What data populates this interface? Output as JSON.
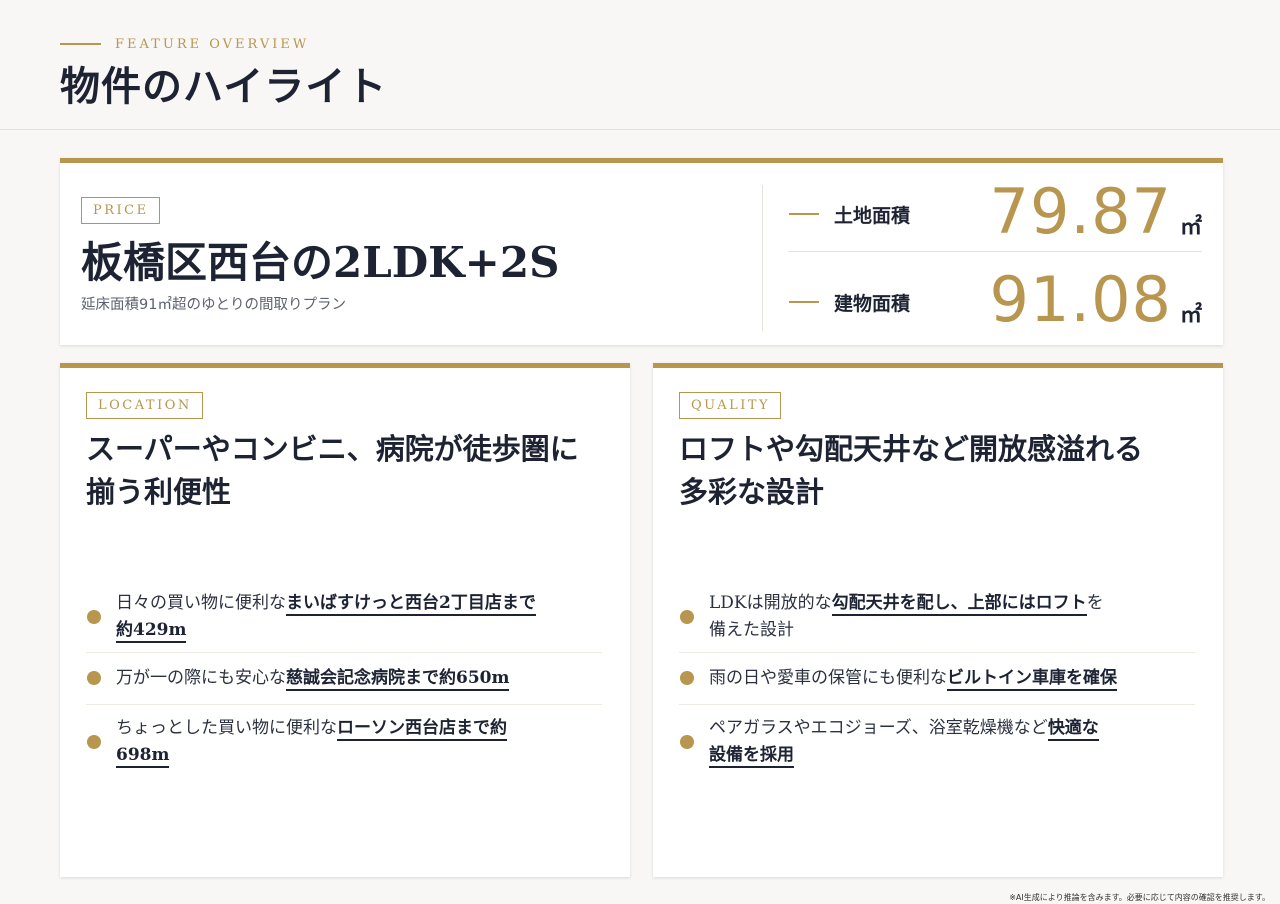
{
  "header": {
    "eyebrow": "FEATURE OVERVIEW",
    "title": "物件のハイライト"
  },
  "price_card": {
    "tag": "PRICE",
    "title": "板橋区西台の2LDK+2S",
    "subtitle": "延床面積91㎡超のゆとりの間取りプラン",
    "metrics": [
      {
        "label": "土地面積",
        "value": "79.87",
        "unit": "㎡"
      },
      {
        "label": "建物面積",
        "value": "91.08",
        "unit": "㎡"
      }
    ]
  },
  "location_card": {
    "tag": "LOCATION",
    "heading_line1": "スーパーやコンビニ、病院が徒歩圏に",
    "heading_line2": "揃う利便性",
    "items": [
      {
        "pre": "日々の買い物に便利な",
        "hl1": "まいばすけっと西台2丁目店まで",
        "hl2": "約429m"
      },
      {
        "pre": "万が一の際にも安心な",
        "hl1": "慈誠会記念病院まで約650m"
      },
      {
        "pre": "ちょっとした買い物に便利な",
        "hl1": "ローソン西台店まで約",
        "hl2": "698m"
      }
    ]
  },
  "quality_card": {
    "tag": "QUALITY",
    "heading_line1": "ロフトや勾配天井など開放感溢れる",
    "heading_line2": "多彩な設計",
    "items": [
      {
        "pre": "LDKは開放的な",
        "hl1": "勾配天井を配し、上部にはロフト",
        "post": "を",
        "line2": "備えた設計"
      },
      {
        "pre": "雨の日や愛車の保管にも便利な",
        "hl1": "ビルトイン車庫を確保"
      },
      {
        "pre": "ペアガラスやエコジョーズ、浴室乾燥機など",
        "hl1": "快適な",
        "hl2": "設備を採用"
      }
    ]
  },
  "footer_note": "※AI生成により推論を含みます。必要に応じて内容の確認を推奨します。",
  "colors": {
    "accent": "#b8964f",
    "text": "#1d2333",
    "background": "#f8f7f5"
  }
}
